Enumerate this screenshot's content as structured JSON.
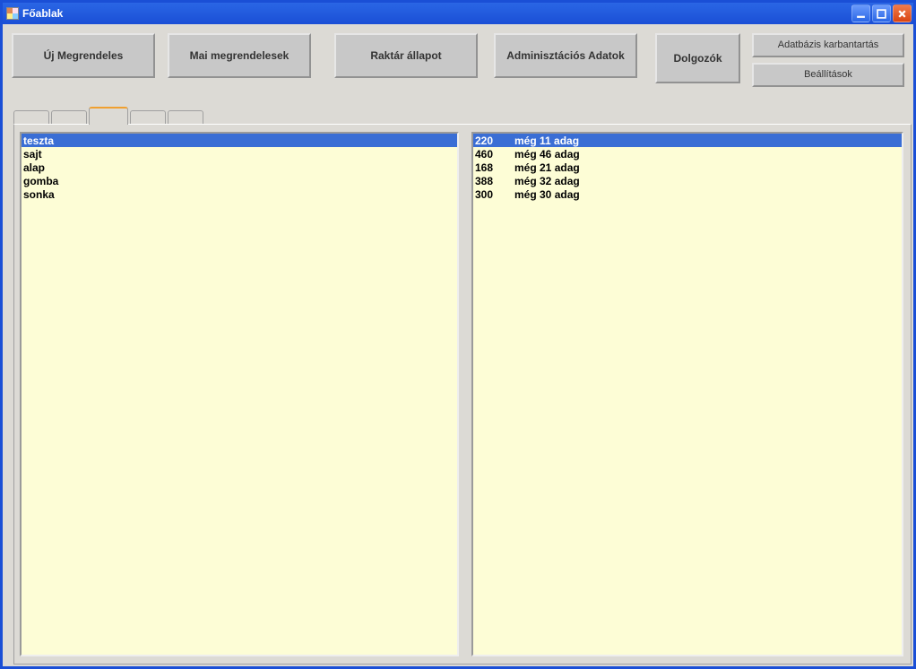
{
  "window": {
    "title": "Főablak"
  },
  "toolbar": {
    "new_order": "Új Megrendeles",
    "today_orders": "Mai megrendelesek",
    "warehouse": "Raktár állapot",
    "admin_data": "Adminisztációs Adatok",
    "employees": "Dolgozók",
    "db_maintenance": "Adatbázis karbantartás",
    "settings": "Beállítások"
  },
  "left_list": [
    {
      "label": "teszta",
      "selected": true
    },
    {
      "label": "sajt",
      "selected": false
    },
    {
      "label": "alap",
      "selected": false
    },
    {
      "label": "gomba",
      "selected": false
    },
    {
      "label": "sonka",
      "selected": false
    }
  ],
  "right_list": [
    {
      "qty": "220",
      "text": "még 11 adag",
      "selected": true
    },
    {
      "qty": "460",
      "text": "még 46 adag",
      "selected": false
    },
    {
      "qty": "168",
      "text": "még 21 adag",
      "selected": false
    },
    {
      "qty": "388",
      "text": "még 32 adag",
      "selected": false
    },
    {
      "qty": "300",
      "text": "még 30 adag",
      "selected": false
    }
  ]
}
